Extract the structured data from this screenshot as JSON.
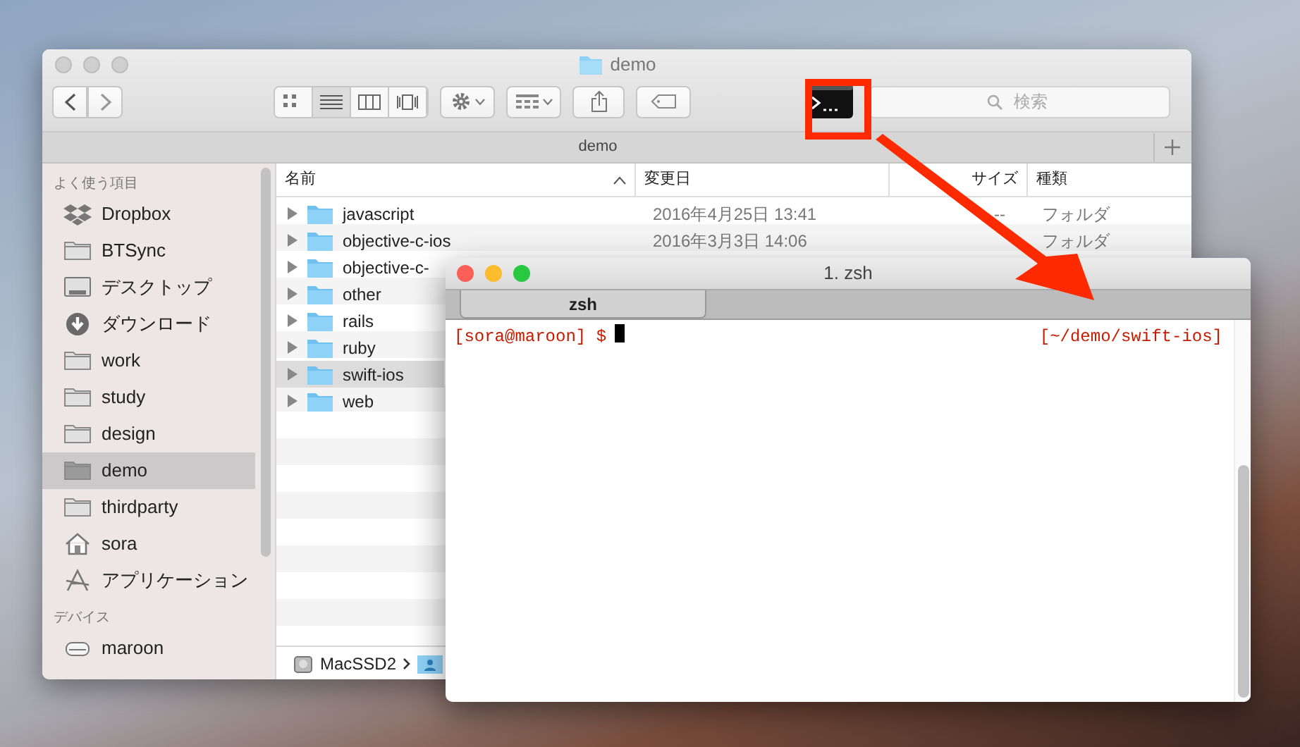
{
  "finder": {
    "title": "demo",
    "toolbar": {
      "search": {
        "placeholder": "検索"
      }
    },
    "path_tab": {
      "label": "demo"
    },
    "sidebar": [
      {
        "heading": "よく使う項目",
        "items": [
          {
            "label": "Dropbox",
            "kind": "dropbox",
            "selected": false
          },
          {
            "label": "BTSync",
            "kind": "folder",
            "selected": false
          },
          {
            "label": "デスクトップ",
            "kind": "desktop",
            "selected": false
          },
          {
            "label": "ダウンロード",
            "kind": "download",
            "selected": false
          },
          {
            "label": "work",
            "kind": "folder",
            "selected": false
          },
          {
            "label": "study",
            "kind": "folder",
            "selected": false
          },
          {
            "label": "design",
            "kind": "folder",
            "selected": false
          },
          {
            "label": "demo",
            "kind": "folder",
            "selected": true
          },
          {
            "label": "thirdparty",
            "kind": "folder",
            "selected": false
          },
          {
            "label": "sora",
            "kind": "home",
            "selected": false
          },
          {
            "label": "アプリケーション",
            "kind": "apps",
            "selected": false
          }
        ]
      },
      {
        "heading": "デバイス",
        "items": [
          {
            "label": "maroon",
            "kind": "disk",
            "selected": false
          }
        ]
      }
    ],
    "columns": [
      {
        "label": "名前",
        "sorted": true
      },
      {
        "label": "変更日",
        "sorted": false
      },
      {
        "label": "サイズ",
        "sorted": false
      },
      {
        "label": "種類",
        "sorted": false
      }
    ],
    "rows": [
      {
        "name": "javascript",
        "date": "2016年4月25日 13:41",
        "size": "--",
        "type": "フォルダ",
        "selected": false
      },
      {
        "name": "objective-c-ios",
        "date": "2016年3月3日 14:06",
        "type": "フォルダ",
        "selected": false
      },
      {
        "name": "objective-c-",
        "selected": false
      },
      {
        "name": "other",
        "selected": false
      },
      {
        "name": "rails",
        "selected": false
      },
      {
        "name": "ruby",
        "selected": false
      },
      {
        "name": "swift-ios",
        "selected": true
      },
      {
        "name": "web",
        "selected": false
      }
    ],
    "path_bar": [
      "MacSSD2"
    ]
  },
  "terminal": {
    "title": "1. zsh",
    "tabs": [
      {
        "label": "zsh",
        "selected": true
      }
    ],
    "prompt_left": "[sora@maroon] $",
    "prompt_right": "[~/demo/swift-ios]"
  }
}
